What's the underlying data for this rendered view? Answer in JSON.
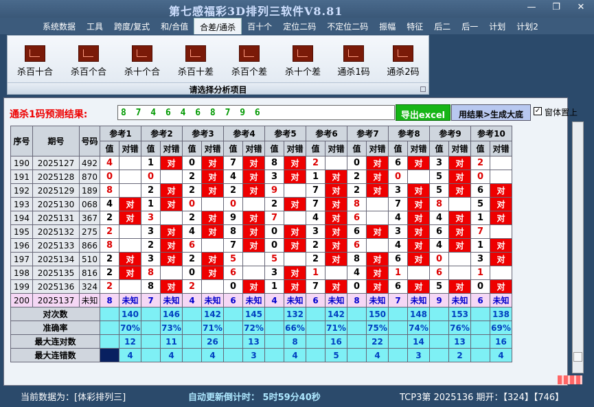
{
  "title": "第七感福彩3D排列三软件V8.81",
  "window_buttons": [
    "—",
    "❐",
    "✕"
  ],
  "menu": [
    "系统数据",
    "工具",
    "跨度/复式",
    "和/合值",
    "合差/通杀",
    "百十个",
    "定位二码",
    "不定位二码",
    "振幅",
    "特征",
    "后二",
    "后一",
    "计划",
    "计划2"
  ],
  "menu_active": 4,
  "ribbon": {
    "buttons": [
      "杀百十合",
      "杀百个合",
      "杀十个合",
      "杀百十差",
      "杀百个差",
      "杀十个差",
      "通杀1码",
      "通杀2码"
    ],
    "caption": "请选择分析项目"
  },
  "result": {
    "label": "通杀1码预测结果:",
    "value": "8 7 4 6 4 6 8 7 9 6",
    "excel_button": "导出excel",
    "gen_button": "用结果>生成大底",
    "pin_label": "窗体置上",
    "pin_checked": "✓"
  },
  "table": {
    "headers": [
      "序号",
      "期号",
      "号码"
    ],
    "ref_headers": [
      "参考1",
      "参考2",
      "参考3",
      "参考4",
      "参考5",
      "参考6",
      "参考7",
      "参考8",
      "参考9",
      "参考10"
    ],
    "sub_value": "值",
    "sub_check": "对错",
    "check_mark": "对",
    "rows": [
      {
        "seq": "190",
        "period": "2025127",
        "num": "492",
        "vals": [
          "4",
          "1",
          "0",
          "7",
          "8",
          "2",
          "0",
          "6",
          "3",
          "2"
        ],
        "red": [
          1,
          0,
          0,
          0,
          0,
          1,
          0,
          0,
          0,
          1
        ],
        "hits": [
          0,
          1,
          1,
          1,
          1,
          0,
          1,
          1,
          1,
          0
        ]
      },
      {
        "seq": "191",
        "period": "2025128",
        "num": "870",
        "vals": [
          "0",
          "0",
          "2",
          "4",
          "3",
          "1",
          "2",
          "0",
          "5",
          "0"
        ],
        "red": [
          1,
          1,
          0,
          0,
          0,
          0,
          0,
          1,
          0,
          1
        ],
        "hits": [
          0,
          0,
          1,
          1,
          1,
          1,
          1,
          0,
          1,
          0
        ]
      },
      {
        "seq": "192",
        "period": "2025129",
        "num": "189",
        "vals": [
          "8",
          "2",
          "2",
          "2",
          "9",
          "7",
          "2",
          "3",
          "5",
          "6"
        ],
        "red": [
          1,
          0,
          0,
          0,
          1,
          0,
          0,
          0,
          0,
          0
        ],
        "hits": [
          0,
          1,
          1,
          1,
          0,
          1,
          1,
          1,
          1,
          1
        ]
      },
      {
        "seq": "193",
        "period": "2025130",
        "num": "068",
        "vals": [
          "4",
          "1",
          "0",
          "0",
          "2",
          "7",
          "8",
          "7",
          "8",
          "5"
        ],
        "red": [
          0,
          0,
          1,
          1,
          0,
          0,
          1,
          0,
          1,
          0
        ],
        "hits": [
          1,
          1,
          0,
          0,
          1,
          1,
          0,
          1,
          0,
          1
        ]
      },
      {
        "seq": "194",
        "period": "2025131",
        "num": "367",
        "vals": [
          "2",
          "3",
          "2",
          "9",
          "7",
          "4",
          "6",
          "4",
          "4",
          "1"
        ],
        "red": [
          0,
          1,
          0,
          0,
          1,
          0,
          1,
          0,
          0,
          0
        ],
        "hits": [
          1,
          0,
          1,
          1,
          0,
          1,
          0,
          1,
          1,
          1
        ]
      },
      {
        "seq": "195",
        "period": "2025132",
        "num": "275",
        "vals": [
          "2",
          "3",
          "4",
          "8",
          "0",
          "3",
          "6",
          "3",
          "6",
          "7"
        ],
        "red": [
          1,
          0,
          0,
          0,
          0,
          0,
          0,
          0,
          0,
          1
        ],
        "hits": [
          0,
          1,
          1,
          1,
          1,
          1,
          1,
          1,
          1,
          0
        ]
      },
      {
        "seq": "196",
        "period": "2025133",
        "num": "866",
        "vals": [
          "8",
          "2",
          "6",
          "7",
          "0",
          "2",
          "6",
          "4",
          "4",
          "1"
        ],
        "red": [
          1,
          0,
          1,
          0,
          0,
          0,
          1,
          0,
          0,
          0
        ],
        "hits": [
          0,
          1,
          0,
          1,
          1,
          1,
          0,
          1,
          1,
          1
        ]
      },
      {
        "seq": "197",
        "period": "2025134",
        "num": "510",
        "vals": [
          "2",
          "3",
          "2",
          "5",
          "5",
          "2",
          "8",
          "6",
          "0",
          "3"
        ],
        "red": [
          0,
          0,
          0,
          1,
          1,
          0,
          0,
          0,
          1,
          0
        ],
        "hits": [
          1,
          1,
          1,
          0,
          0,
          1,
          1,
          1,
          0,
          1
        ]
      },
      {
        "seq": "198",
        "period": "2025135",
        "num": "816",
        "vals": [
          "2",
          "8",
          "0",
          "6",
          "3",
          "1",
          "4",
          "1",
          "6",
          "1"
        ],
        "red": [
          0,
          1,
          0,
          1,
          0,
          1,
          0,
          1,
          1,
          1
        ],
        "hits": [
          1,
          0,
          1,
          0,
          1,
          0,
          1,
          0,
          0,
          0
        ]
      },
      {
        "seq": "199",
        "period": "2025136",
        "num": "324",
        "vals": [
          "2",
          "8",
          "2",
          "0",
          "1",
          "7",
          "0",
          "6",
          "5",
          "0"
        ],
        "red": [
          1,
          0,
          1,
          0,
          0,
          0,
          0,
          0,
          0,
          0
        ],
        "hits": [
          0,
          1,
          0,
          1,
          1,
          1,
          1,
          1,
          1,
          1
        ]
      }
    ],
    "predict": {
      "seq": "200",
      "period": "2025137",
      "num": "未知",
      "vals": [
        "8",
        "7",
        "4",
        "6",
        "4",
        "6",
        "8",
        "7",
        "9",
        "6"
      ],
      "check": "未知"
    },
    "stats": [
      {
        "label": "对次数",
        "vals": [
          "140",
          "146",
          "142",
          "145",
          "132",
          "142",
          "150",
          "148",
          "153",
          "138"
        ]
      },
      {
        "label": "准确率",
        "vals": [
          "70%",
          "73%",
          "71%",
          "72%",
          "66%",
          "71%",
          "75%",
          "74%",
          "76%",
          "69%"
        ]
      },
      {
        "label": "最大连对数",
        "vals": [
          "12",
          "11",
          "26",
          "13",
          "8",
          "16",
          "22",
          "14",
          "13",
          "16"
        ]
      },
      {
        "label": "最大连错数",
        "vals": [
          "4",
          "4",
          "4",
          "3",
          "4",
          "5",
          "4",
          "3",
          "2",
          "4"
        ]
      }
    ]
  },
  "status": {
    "current": "当前数据为：[体彩排列三]",
    "countdown": "自动更新倒计时： 5时59分40秒",
    "draw": "TCP3第 2025136 期开：【324】【746】"
  }
}
